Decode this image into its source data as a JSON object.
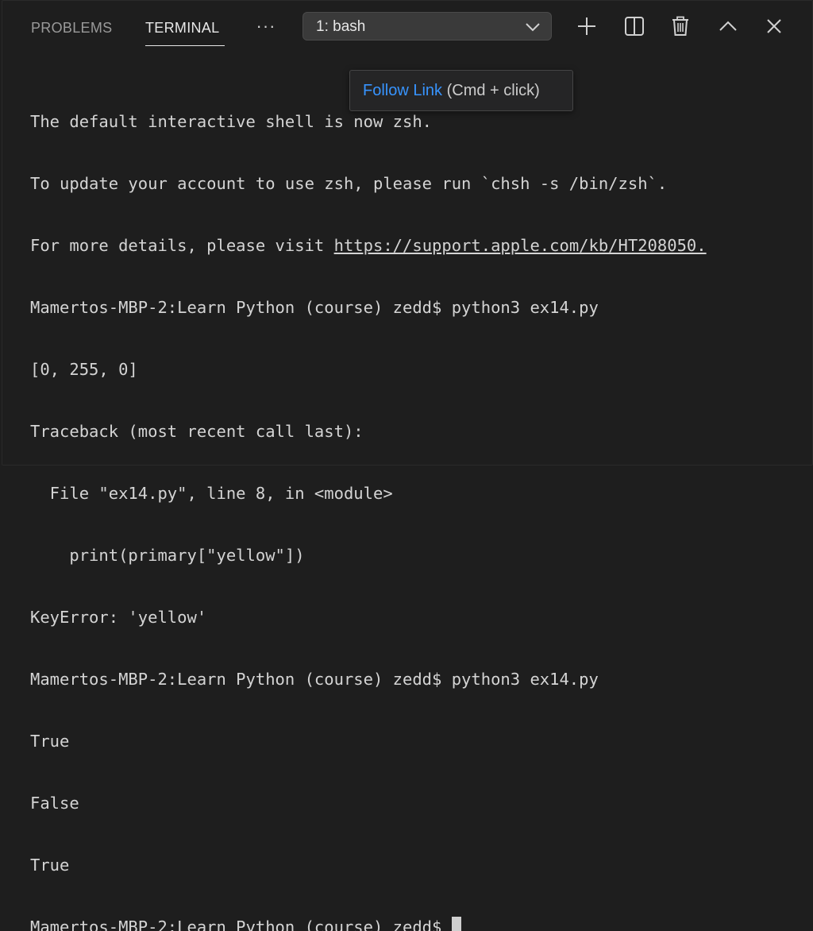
{
  "tabs": {
    "problems": "PROBLEMS",
    "terminal": "TERMINAL",
    "more": "···"
  },
  "terminal_select": {
    "selected": "1: bash"
  },
  "toolbar": {
    "icons": [
      "plus-icon",
      "split-icon",
      "trash-icon",
      "chevron-up-icon",
      "close-icon"
    ]
  },
  "terminal": {
    "lines": [
      "The default interactive shell is now zsh.",
      "To update your account to use zsh, please run `chsh -s /bin/zsh`.",
      "For more details, please visit ",
      "Mamertos-MBP-2:Learn Python (course) zedd$ python3 ex14.py",
      "[0, 255, 0]",
      "Traceback (most recent call last):",
      "  File \"ex14.py\", line 8, in <module>",
      "    print(primary[\"yellow\"])",
      "KeyError: 'yellow'",
      "Mamertos-MBP-2:Learn Python (course) zedd$ python3 ex14.py",
      "True",
      "False",
      "True",
      "Mamertos-MBP-2:Learn Python (course) zedd$ "
    ],
    "link": "https://support.apple.com/kb/HT208050."
  },
  "tooltip": {
    "action": "Follow Link",
    "hint": " (Cmd + click)"
  },
  "colors": {
    "background": "#1e1e1e",
    "link_accent": "#3794ff",
    "text": "#d4d4d4"
  }
}
